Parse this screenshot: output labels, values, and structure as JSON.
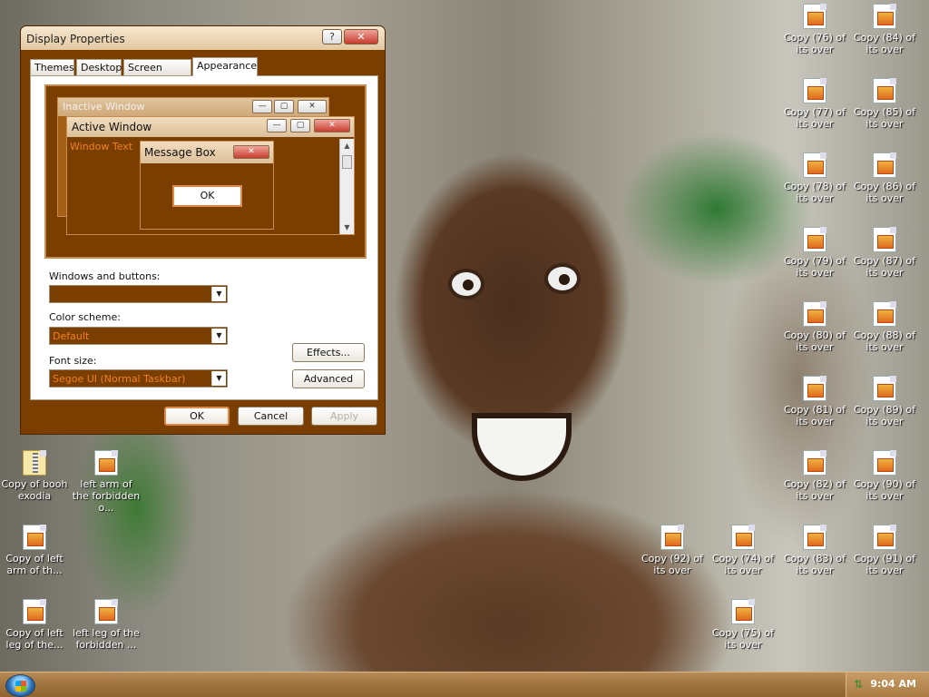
{
  "dialog": {
    "title": "Display Properties",
    "help_label": "?",
    "close_label": "✕",
    "tabs": [
      "Themes",
      "Desktop",
      "Screen Saver",
      "Appearance"
    ],
    "active_tab": "Appearance",
    "preview": {
      "inactive_title": "Inactive Window",
      "active_title": "Active Window",
      "window_text": "Window Text",
      "message_box_title": "Message Box",
      "ok_label": "OK",
      "min_label": "—",
      "max_label": "▢",
      "close_label": "✕"
    },
    "windows_buttons": {
      "label": "Windows and buttons:",
      "value": ""
    },
    "color_scheme": {
      "label": "Color scheme:",
      "value": "Default"
    },
    "font_size": {
      "label": "Font size:",
      "value": "Segoe UI (Normal Taskbar)"
    },
    "effects_label": "Effects...",
    "advanced_label": "Advanced",
    "ok_label": "OK",
    "cancel_label": "Cancel",
    "apply_label": "Apply",
    "dropdown_arrow": "▼",
    "colors": {
      "accent": "#7a3f00",
      "highlight_text": "#f08020",
      "focus_border": "#e08a4a"
    }
  },
  "desktop_icons": [
    {
      "label": "Copy (76) of its over"
    },
    {
      "label": "Copy (84) of its over"
    },
    {
      "label": "Copy (77) of its over"
    },
    {
      "label": "Copy (85) of its over"
    },
    {
      "label": "Copy (78) of its over"
    },
    {
      "label": "Copy (86) of its over"
    },
    {
      "label": "Copy (79) of its over"
    },
    {
      "label": "Copy (87) of its over"
    },
    {
      "label": "Copy (80) of its over"
    },
    {
      "label": "Copy (88) of its over"
    },
    {
      "label": "Copy (81) of its over"
    },
    {
      "label": "Copy (89) of its over"
    },
    {
      "label": "Copy (82) of its over"
    },
    {
      "label": "Copy (90) of its over"
    },
    {
      "label": "Copy (83) of its over"
    },
    {
      "label": "Copy (91) of its over"
    },
    {
      "label": "Copy (92) of its over"
    },
    {
      "label": "Copy (74) of its over"
    },
    {
      "label": "Copy (75) of its over"
    },
    {
      "label": "Copy of booh exodia"
    },
    {
      "label": "left arm of the forbidden o..."
    },
    {
      "label": "Copy of left arm of th..."
    },
    {
      "label": "Copy of left leg of the..."
    },
    {
      "label": "left leg of the forbidden ..."
    }
  ],
  "taskbar": {
    "clock": "9:04 AM"
  }
}
